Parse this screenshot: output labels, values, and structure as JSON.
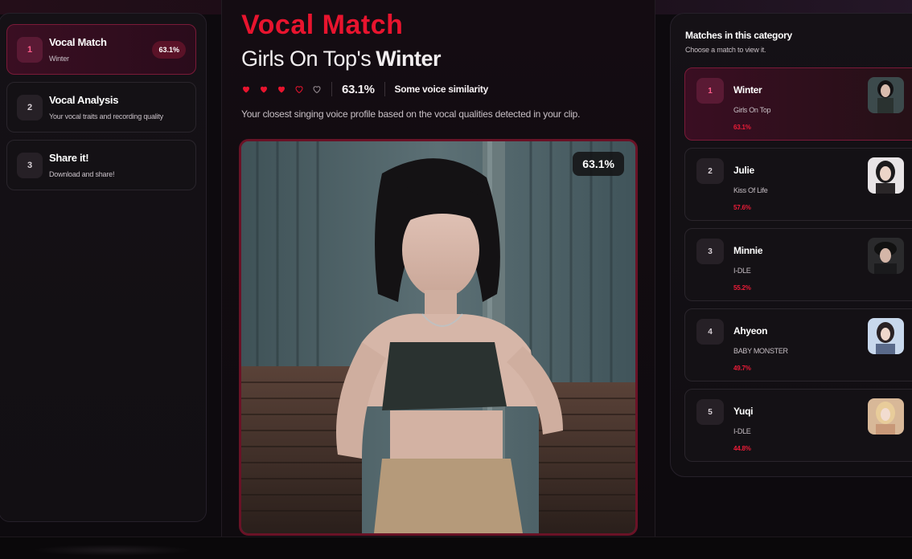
{
  "steps": [
    {
      "num": "1",
      "title": "Vocal Match",
      "sub": "Winter",
      "badge": "63.1%"
    },
    {
      "num": "2",
      "title": "Vocal Analysis",
      "sub": "Your vocal traits and recording quality"
    },
    {
      "num": "3",
      "title": "Share it!",
      "sub": "Download and share!"
    }
  ],
  "main": {
    "title": "Vocal Match",
    "artist": "Girls On Top's",
    "name": "Winter",
    "rating": {
      "filled_hearts": 3,
      "total_hearts": 5,
      "percent": "63.1%",
      "label": "Some voice similarity"
    },
    "description": "Your closest singing voice profile based on the vocal qualities detected in your clip.",
    "photo_badge": "63.1%"
  },
  "matches": {
    "title": "Matches in this category",
    "subtitle": "Choose a match to view it.",
    "items": [
      {
        "num": "1",
        "name": "Winter",
        "group": "Girls On Top",
        "pct": "63.1%"
      },
      {
        "num": "2",
        "name": "Julie",
        "group": "Kiss Of Life",
        "pct": "57.6%"
      },
      {
        "num": "3",
        "name": "Minnie",
        "group": "I-DLE",
        "pct": "55.2%"
      },
      {
        "num": "4",
        "name": "Ahyeon",
        "group": "BABY MONSTER",
        "pct": "49.7%"
      },
      {
        "num": "5",
        "name": "Yuqi",
        "group": "I-DLE",
        "pct": "44.8%"
      }
    ]
  },
  "colors": {
    "accent": "#e8142e",
    "active_border": "#7a1a38",
    "background": "#0d0a0e"
  }
}
